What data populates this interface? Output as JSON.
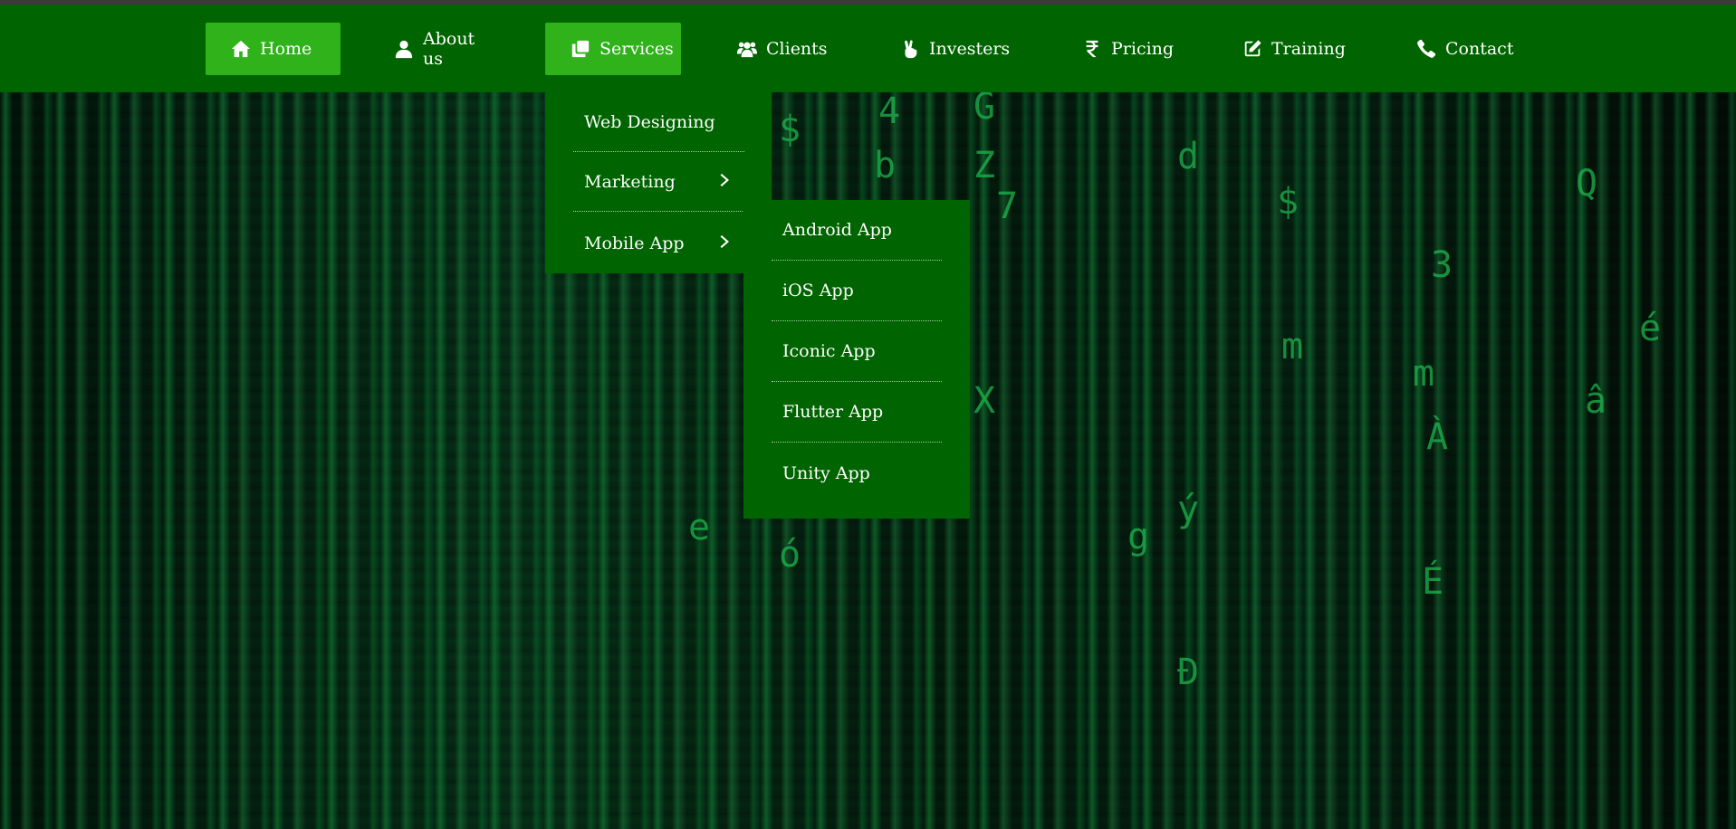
{
  "nav": {
    "items": [
      {
        "label": "Home",
        "icon": "home-icon",
        "active": true
      },
      {
        "label": "About us",
        "icon": "user-icon"
      },
      {
        "label": "Services",
        "icon": "clone-icon",
        "active": true
      },
      {
        "label": "Clients",
        "icon": "users-icon"
      },
      {
        "label": "Investers",
        "icon": "peace-hand-icon"
      },
      {
        "label": "Pricing",
        "icon": "rupee-icon"
      },
      {
        "label": "Training",
        "icon": "edit-icon"
      },
      {
        "label": "Contact",
        "icon": "phone-icon"
      }
    ]
  },
  "services_menu": {
    "items": [
      {
        "label": "Web Designing"
      },
      {
        "label": "Marketing",
        "has_submenu": true
      },
      {
        "label": "Mobile App",
        "has_submenu": true
      }
    ]
  },
  "mobile_app_menu": {
    "items": [
      {
        "label": "Android App"
      },
      {
        "label": "iOS App"
      },
      {
        "label": "Iconic App"
      },
      {
        "label": "Flutter App"
      },
      {
        "label": "Unity App"
      }
    ]
  },
  "colors": {
    "navbar": "#006400",
    "active": "#2fb21a",
    "text": "#ffffff"
  }
}
